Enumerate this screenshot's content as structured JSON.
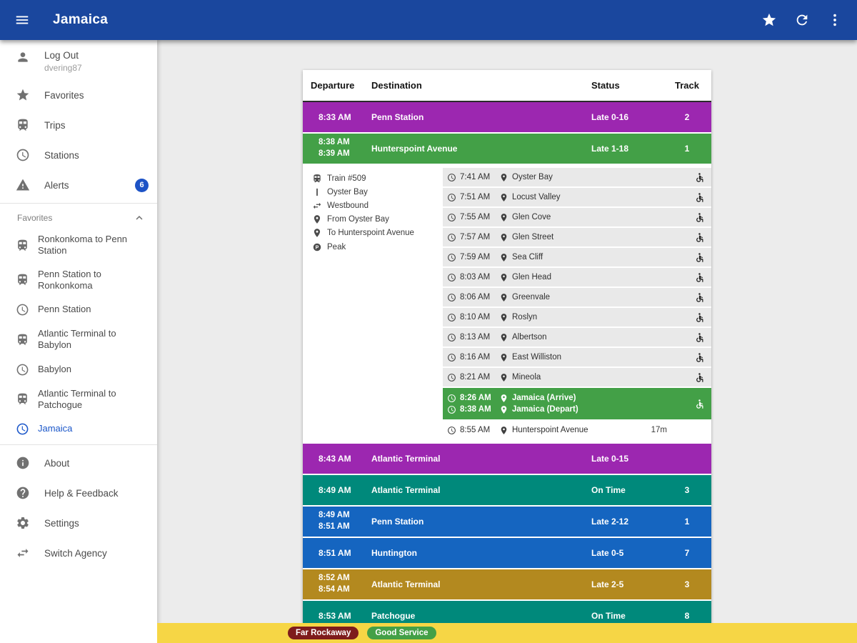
{
  "colors": {
    "app_bar_bg": "#1a479e",
    "accent_blue": "#1a56c9",
    "alerts_badge_bg": "#1d53c6",
    "content_bg": "#ececec"
  },
  "app_bar": {
    "title": "Jamaica",
    "actions": [
      {
        "icon": "star",
        "name": "favorite-button"
      },
      {
        "icon": "refresh",
        "name": "refresh-button"
      },
      {
        "icon": "dots",
        "name": "overflow-menu-button"
      }
    ]
  },
  "sidebar": {
    "logout": {
      "icon": "person",
      "label": "Log Out",
      "username": "dvering87"
    },
    "nav_items": [
      {
        "icon": "star",
        "label": "Favorites"
      },
      {
        "icon": "train",
        "label": "Trips"
      },
      {
        "icon": "clock",
        "label": "Stations"
      },
      {
        "icon": "alert",
        "label": "Alerts",
        "badge": "6"
      }
    ],
    "favorites_header": {
      "label": "Favorites",
      "collapse_icon": "chevron-up"
    },
    "favorites": [
      {
        "icon": "train",
        "label": "Ronkonkoma to Penn Station"
      },
      {
        "icon": "train",
        "label": "Penn Station to Ronkonkoma"
      },
      {
        "icon": "clock",
        "label": "Penn Station"
      },
      {
        "icon": "train",
        "label": "Atlantic Terminal to Babylon"
      },
      {
        "icon": "clock",
        "label": "Babylon"
      },
      {
        "icon": "train",
        "label": "Atlantic Terminal to Patchogue"
      },
      {
        "icon": "clock",
        "label": "Jamaica",
        "active": true
      }
    ],
    "footer_items": [
      {
        "icon": "info",
        "label": "About"
      },
      {
        "icon": "help",
        "label": "Help & Feedback"
      },
      {
        "icon": "gear",
        "label": "Settings"
      },
      {
        "icon": "swap",
        "label": "Switch Agency"
      }
    ]
  },
  "schedule": {
    "headers": {
      "departure": "Departure",
      "destination": "Destination",
      "status": "Status",
      "track": "Track"
    },
    "rows": [
      {
        "times": [
          "8:33 AM"
        ],
        "destination": "Penn Station",
        "status": "Late 0-16",
        "track": "2",
        "color": "#9c27b0"
      },
      {
        "times": [
          "8:38 AM",
          "8:39 AM"
        ],
        "destination": "Hunterspoint Avenue",
        "status": "Late 1-18",
        "track": "1",
        "color": "#43a047",
        "expanded": true
      },
      {
        "times": [
          "8:43 AM"
        ],
        "destination": "Atlantic Terminal",
        "status": "Late 0-15",
        "track": "",
        "color": "#9c27b0"
      },
      {
        "times": [
          "8:49 AM"
        ],
        "destination": "Atlantic Terminal",
        "status": "On Time",
        "track": "3",
        "color": "#00897b"
      },
      {
        "times": [
          "8:49 AM",
          "8:51 AM"
        ],
        "destination": "Penn Station",
        "status": "Late 2-12",
        "track": "1",
        "color": "#1565c0"
      },
      {
        "times": [
          "8:51 AM"
        ],
        "destination": "Huntington",
        "status": "Late 0-5",
        "track": "7",
        "color": "#1565c0"
      },
      {
        "times": [
          "8:52 AM",
          "8:54 AM"
        ],
        "destination": "Atlantic Terminal",
        "status": "Late 2-5",
        "track": "3",
        "color": "#b3891f"
      },
      {
        "times": [
          "8:53 AM"
        ],
        "destination": "Patchogue",
        "status": "On Time",
        "track": "8",
        "color": "#00897b"
      }
    ],
    "trip_details": {
      "highlight_color": "#43a047",
      "info": [
        {
          "icon": "train",
          "text": "Train #509"
        },
        {
          "icon": "route",
          "text": "Oyster Bay"
        },
        {
          "icon": "swap",
          "text": "Westbound"
        },
        {
          "icon": "pin",
          "text": "From Oyster Bay"
        },
        {
          "icon": "pin",
          "text": "To Hunterspoint Avenue"
        },
        {
          "icon": "peak",
          "text": "Peak"
        }
      ],
      "stops": [
        {
          "times": [
            "7:41 AM"
          ],
          "names": [
            "Oyster Bay"
          ],
          "accessible": true
        },
        {
          "times": [
            "7:51 AM"
          ],
          "names": [
            "Locust Valley"
          ],
          "accessible": true
        },
        {
          "times": [
            "7:55 AM"
          ],
          "names": [
            "Glen Cove"
          ],
          "accessible": true
        },
        {
          "times": [
            "7:57 AM"
          ],
          "names": [
            "Glen Street"
          ],
          "accessible": true
        },
        {
          "times": [
            "7:59 AM"
          ],
          "names": [
            "Sea Cliff"
          ],
          "accessible": true
        },
        {
          "times": [
            "8:03 AM"
          ],
          "names": [
            "Glen Head"
          ],
          "accessible": true
        },
        {
          "times": [
            "8:06 AM"
          ],
          "names": [
            "Greenvale"
          ],
          "accessible": true
        },
        {
          "times": [
            "8:10 AM"
          ],
          "names": [
            "Roslyn"
          ],
          "accessible": true
        },
        {
          "times": [
            "8:13 AM"
          ],
          "names": [
            "Albertson"
          ],
          "accessible": true
        },
        {
          "times": [
            "8:16 AM"
          ],
          "names": [
            "East Williston"
          ],
          "accessible": true
        },
        {
          "times": [
            "8:21 AM"
          ],
          "names": [
            "Mineola"
          ],
          "accessible": true
        },
        {
          "times": [
            "8:26 AM",
            "8:38 AM"
          ],
          "names": [
            "Jamaica (Arrive)",
            "Jamaica (Depart)"
          ],
          "accessible": true,
          "highlight": true
        },
        {
          "times": [
            "8:55 AM"
          ],
          "names": [
            "Hunterspoint Avenue"
          ],
          "duration": "17m",
          "accessible": false,
          "plain": true
        }
      ]
    }
  },
  "alert_bar": {
    "bg": "#f6d645",
    "line": {
      "label": "Far Rockaway",
      "color": "#7e1c1c"
    },
    "service": {
      "label": "Good Service",
      "color": "#43a047"
    }
  }
}
